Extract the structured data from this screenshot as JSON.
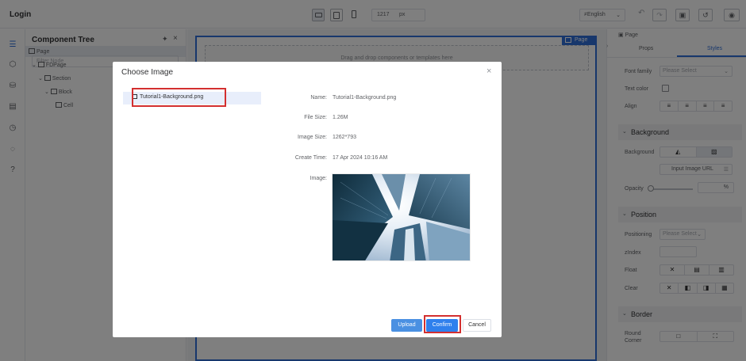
{
  "app": {
    "title": "Login",
    "toolbar": {
      "device_buttons": [
        "desktop-icon",
        "tablet-icon",
        "mobile-icon"
      ],
      "width_value": "1217",
      "width_unit": "px",
      "language": "≠English",
      "icons": [
        "undo-icon",
        "redo-icon",
        "save-icon",
        "history-icon",
        "preview-icon"
      ]
    }
  },
  "sidebar_icons": [
    "component-tree-icon",
    "components-icon",
    "data-source-icon",
    "code-icon",
    "history-icon",
    "comment-icon",
    "help-icon"
  ],
  "component_tree": {
    "title": "Component Tree",
    "filter_placeholder": "Filter Node",
    "nodes": [
      {
        "label": "Page",
        "depth": 0
      },
      {
        "label": "FDPage",
        "depth": 1
      },
      {
        "label": "Section",
        "depth": 2
      },
      {
        "label": "Block",
        "depth": 3
      },
      {
        "label": "Cell",
        "depth": 4
      }
    ]
  },
  "canvas": {
    "drop_hint": "Drag and drop components or templates here",
    "page_tag": "Page"
  },
  "properties": {
    "header": "Page",
    "tabs": [
      "Props",
      "Styles"
    ],
    "active_tab": "Styles",
    "font_family_label": "Font family",
    "font_family_placeholder": "Please Select",
    "text_color_label": "Text color",
    "align_label": "Align",
    "align_options": [
      "≡",
      "≡",
      "≡",
      "≡"
    ],
    "background_section": "Background",
    "background_label": "Background",
    "input_image_url": "Input Image URL",
    "opacity_label": "Opacity",
    "opacity_unit": "%",
    "position_section": "Position",
    "positioning_label": "Positioning",
    "positioning_placeholder": "Please Select",
    "zindex_label": "zIndex",
    "float_label": "Float",
    "clear_label": "Clear",
    "border_section": "Border",
    "round_corner_label": "Round Corner"
  },
  "dialog": {
    "title": "Choose Image",
    "file_name": "Tutorial1-Background.png",
    "details": [
      {
        "label": "Name:",
        "value": "Tutorial1-Background.png"
      },
      {
        "label": "File Size:",
        "value": "1.26M"
      },
      {
        "label": "Image Size:",
        "value": "1262*793"
      },
      {
        "label": "Create Time:",
        "value": "17 Apr 2024 10:16 AM"
      },
      {
        "label": "Image:",
        "value": ""
      }
    ],
    "buttons": {
      "upload": "Upload",
      "confirm": "Confirm",
      "cancel": "Cancel"
    },
    "accent_color": "#2f80ed",
    "highlight_color": "#d32f2f"
  }
}
